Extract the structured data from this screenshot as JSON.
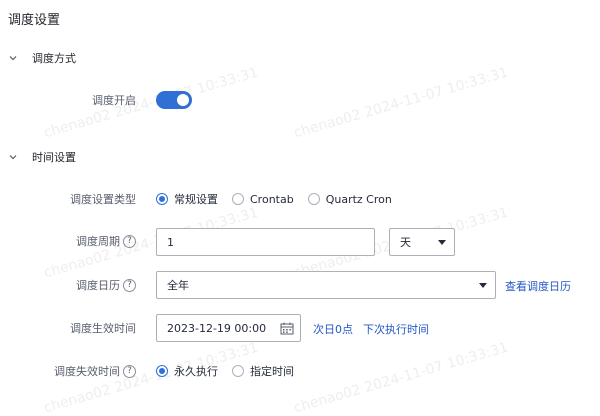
{
  "page": {
    "title": "调度设置"
  },
  "sections": {
    "mode": {
      "title": "调度方式",
      "enable_label": "调度开启",
      "enabled": true
    },
    "time": {
      "title": "时间设置"
    }
  },
  "schedule_type": {
    "label": "调度设置类型",
    "options": [
      "常规设置",
      "Crontab",
      "Quartz Cron"
    ],
    "selected": "常规设置"
  },
  "period": {
    "label": "调度周期",
    "value": "1",
    "unit": "天"
  },
  "calendar": {
    "label": "调度日历",
    "value": "全年",
    "link": "查看调度日历"
  },
  "effective": {
    "label": "调度生效时间",
    "value": "2023-12-19 00:00",
    "link_day": "次日0点",
    "link_next": "下次执行时间"
  },
  "expire": {
    "label": "调度失效时间",
    "options": [
      "永久执行",
      "指定时间"
    ],
    "selected": "永久执行"
  },
  "help_glyph": "?",
  "watermark": "chenao02 2024-11-07 10:33:31",
  "colors": {
    "accent": "#2f6fd6",
    "link": "#2458c6"
  }
}
